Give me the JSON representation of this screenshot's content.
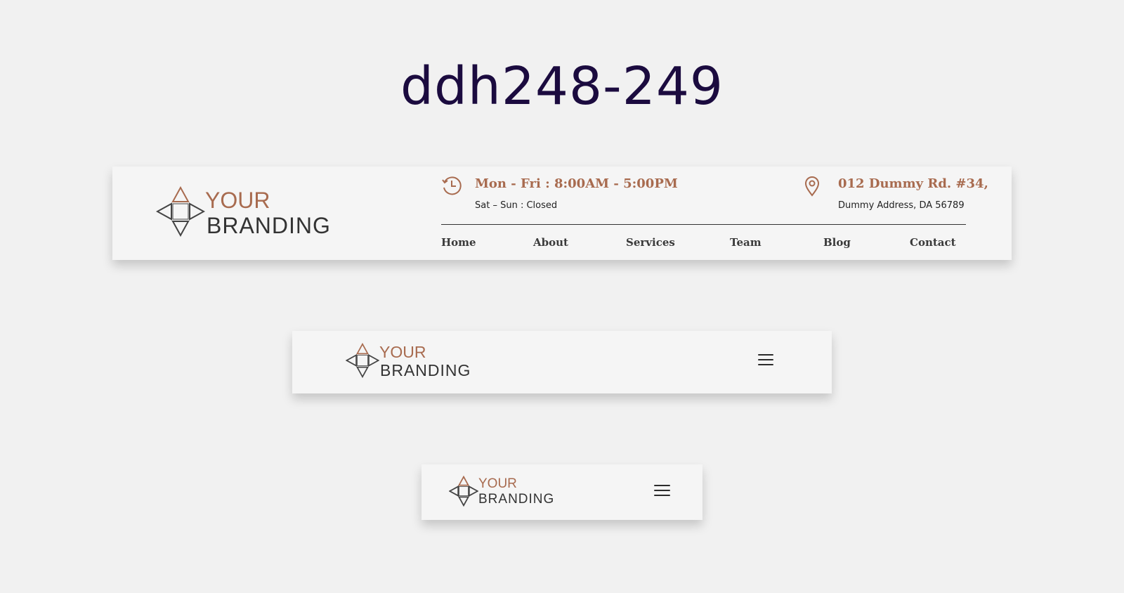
{
  "page": {
    "title": "ddh248-249"
  },
  "logo": {
    "line1": "YOUR",
    "line2": "BRANDING"
  },
  "desktop": {
    "hours": {
      "main": "Mon - Fri : 8:00AM - 5:00PM",
      "sub": "Sat – Sun : Closed",
      "icon": "clock-history-icon"
    },
    "address": {
      "main": "012 Dummy Rd. #34,",
      "sub": "Dummy Address, DA 56789",
      "icon": "map-pin-icon"
    },
    "nav": [
      "Home",
      "About",
      "Services",
      "Team",
      "Blog",
      "Contact"
    ]
  },
  "menu_icon": "hamburger-menu-icon",
  "colors": {
    "accent": "#a86b4f",
    "dark": "#333333",
    "title": "#1b0b3f",
    "background": "#f1f1f1",
    "header_bg": "#f5f5f5"
  }
}
